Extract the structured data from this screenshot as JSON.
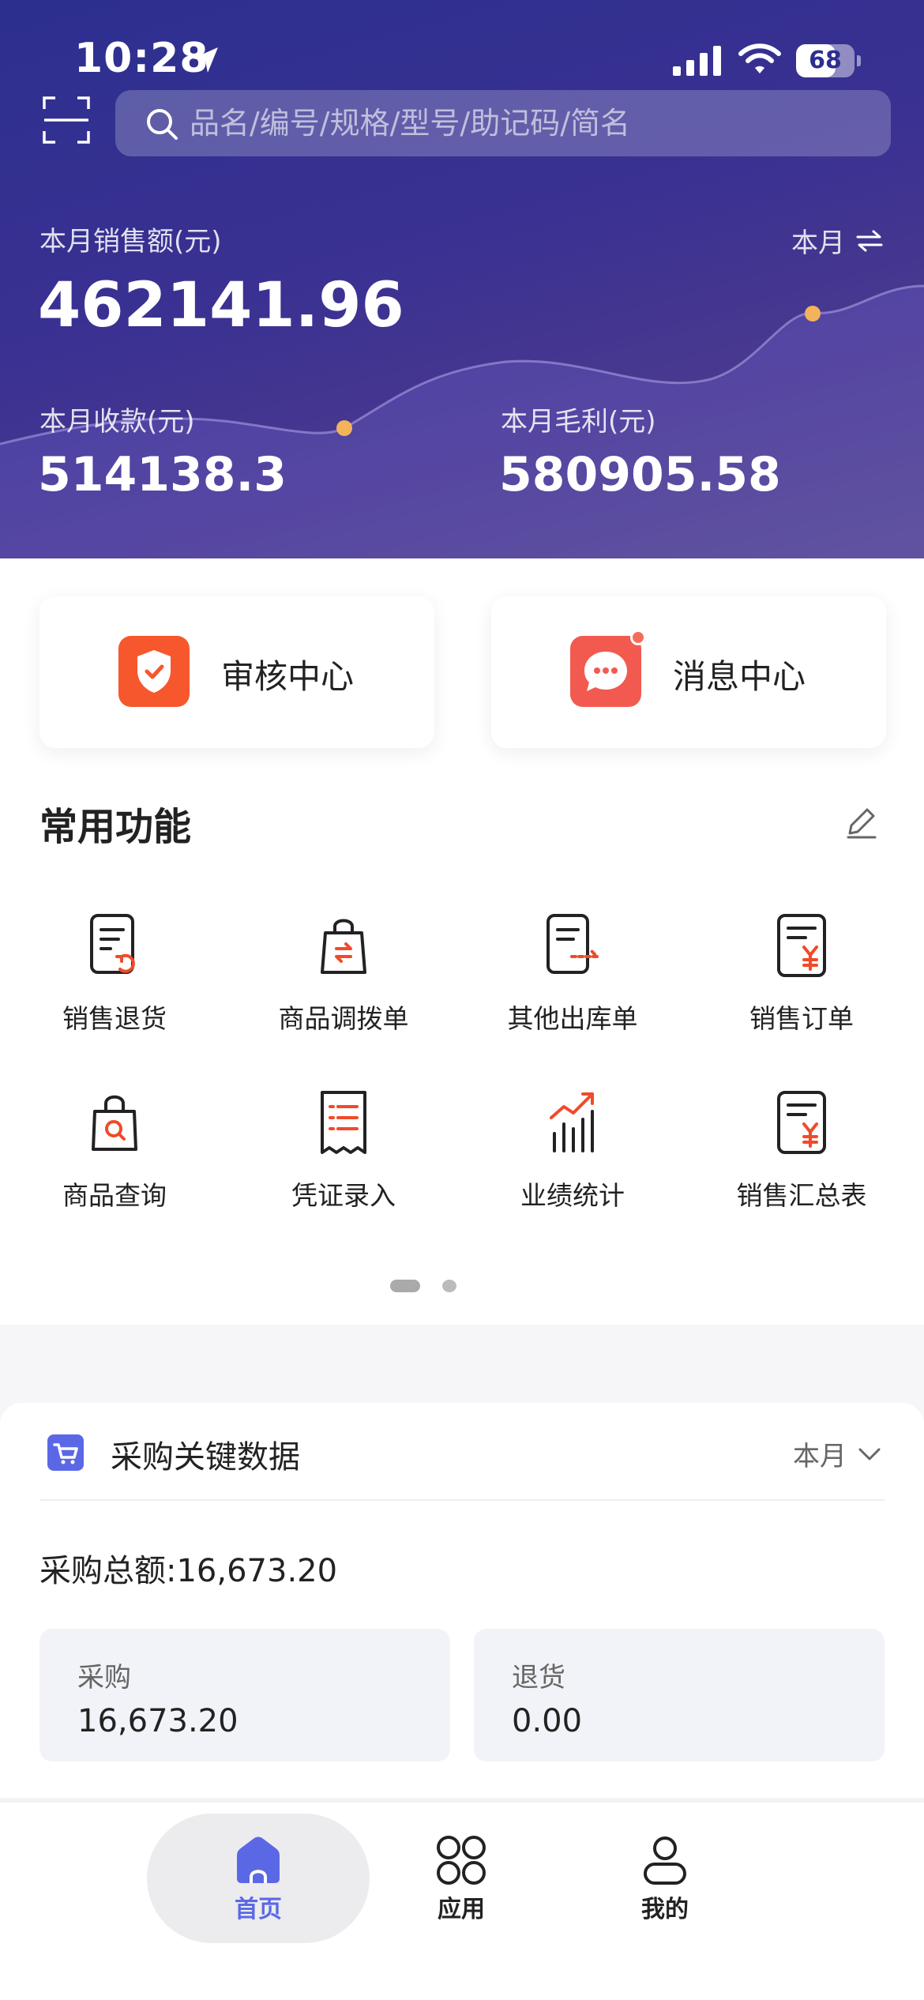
{
  "status_bar": {
    "time": "10:28",
    "battery": "68",
    "battery_level": 0.68
  },
  "search": {
    "placeholder": "品名/编号/规格/型号/助记码/简名"
  },
  "sales": {
    "monthly_sales_label": "本月销售额(元)",
    "monthly_sales_value": "462141.96",
    "period_label": "本月",
    "monthly_receipts_label": "本月收款(元)",
    "monthly_receipts_value": "514138.3",
    "monthly_profit_label": "本月毛利(元)",
    "monthly_profit_value": "580905.58"
  },
  "quick_cards": [
    {
      "label": "审核中心",
      "icon": "shield-check-icon",
      "color": "#f7572c"
    },
    {
      "label": "消息中心",
      "icon": "chat-bubble-icon",
      "color": "#f25a50"
    }
  ],
  "common_functions": {
    "title": "常用功能",
    "items": [
      {
        "label": "销售退货",
        "icon": "sales-return-icon"
      },
      {
        "label": "商品调拨单",
        "icon": "transfer-bag-icon"
      },
      {
        "label": "其他出库单",
        "icon": "outbound-doc-icon"
      },
      {
        "label": "销售订单",
        "icon": "sales-order-icon"
      },
      {
        "label": "商品查询",
        "icon": "product-search-icon"
      },
      {
        "label": "凭证录入",
        "icon": "voucher-icon"
      },
      {
        "label": "业绩统计",
        "icon": "performance-chart-icon"
      },
      {
        "label": "销售汇总表",
        "icon": "sales-summary-icon"
      }
    ]
  },
  "purchase": {
    "title": "采购关键数据",
    "period": "本月",
    "total_label": "采购总额:",
    "total_value": "16,673.20",
    "boxes": [
      {
        "label": "采购",
        "value": "16,673.20"
      },
      {
        "label": "退货",
        "value": "0.00"
      }
    ]
  },
  "tabbar": [
    {
      "label": "首页",
      "active": true
    },
    {
      "label": "应用",
      "active": false
    },
    {
      "label": "我的",
      "active": false
    }
  ],
  "colors": {
    "brand": "#2c2f8f",
    "accent": "#5b68e6",
    "icon_red": "#f04a2a",
    "highlight_dot": "#f3b35b"
  }
}
